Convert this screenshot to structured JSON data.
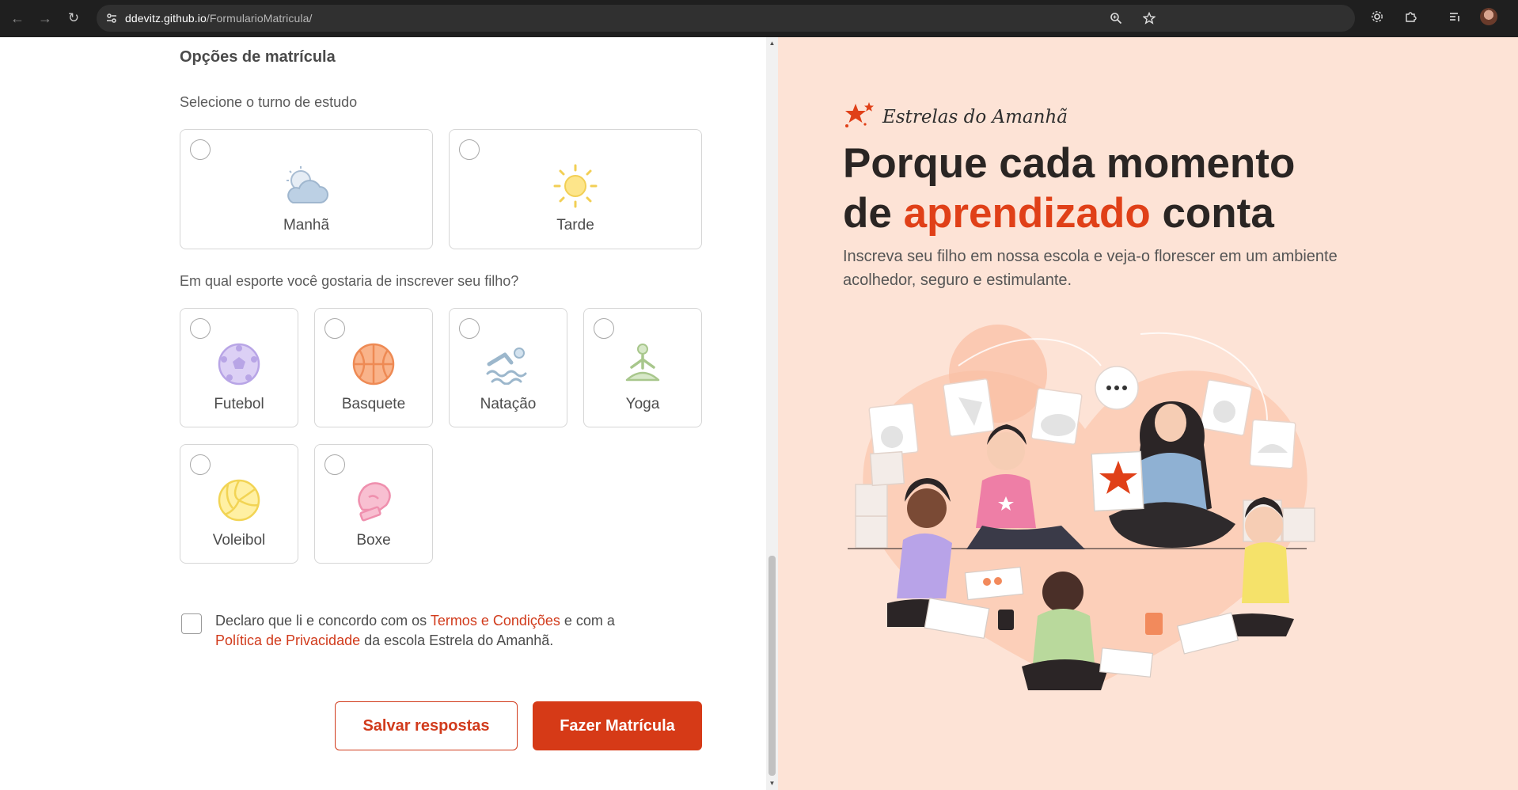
{
  "browser": {
    "url_host": "ddevitz.github.io",
    "url_path": "/FormularioMatricula/"
  },
  "form": {
    "section_title": "Opções de matrícula",
    "shift_question": "Selecione o turno de estudo",
    "shifts": [
      {
        "label": "Manhã",
        "icon": "cloud-sun-icon"
      },
      {
        "label": "Tarde",
        "icon": "sun-icon"
      }
    ],
    "sport_question": "Em qual esporte você gostaria de inscrever seu filho?",
    "sports": [
      {
        "label": "Futebol",
        "icon": "soccer-ball-icon"
      },
      {
        "label": "Basquete",
        "icon": "basketball-icon"
      },
      {
        "label": "Natação",
        "icon": "swimmer-icon"
      },
      {
        "label": "Yoga",
        "icon": "yoga-icon"
      },
      {
        "label": "Voleibol",
        "icon": "volleyball-icon"
      },
      {
        "label": "Boxe",
        "icon": "boxing-glove-icon"
      }
    ],
    "terms": {
      "part1": "Declaro que li e concordo com os ",
      "link1": "Termos e Condições",
      "part2": " e com a ",
      "link2": "Política de Privacidade",
      "part3": " da escola Estrela do Amanhã."
    },
    "save_label": "Salvar respostas",
    "submit_label": "Fazer Matrícula"
  },
  "hero": {
    "brand": "Estrelas do Amanhã",
    "headline_line1": "Porque cada momento",
    "headline_prefix": "de ",
    "headline_accent": "aprendizado",
    "headline_suffix": " conta",
    "subtext": "Inscreva seu filho em nossa escola e veja-o florescer em um ambiente acolhedor, seguro e estimulante."
  },
  "colors": {
    "accent": "#d63a17",
    "hero_bg": "#fde3d6"
  }
}
